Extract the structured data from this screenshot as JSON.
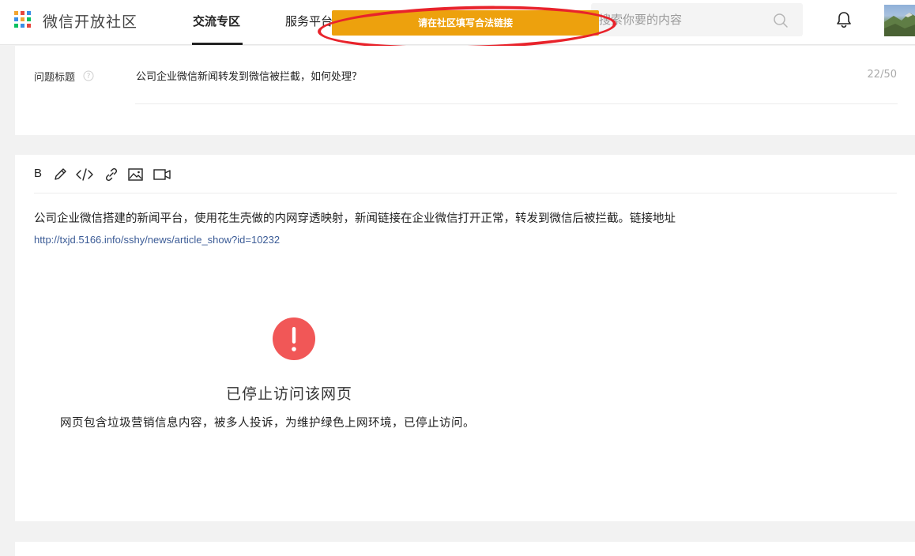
{
  "header": {
    "logo_text": "微信开放社区",
    "nav": [
      {
        "label": "交流专区",
        "active": true
      },
      {
        "label": "服务平台",
        "active": false
      }
    ],
    "search": {
      "placeholder": "搜索你要的内容"
    },
    "toast": "请在社区填写合法链接"
  },
  "question": {
    "label": "问题标题",
    "title_value": "公司企业微信新闻转发到微信被拦截，如何处理？",
    "char_count": "22/50"
  },
  "editor": {
    "toolbar": {
      "bold": "B"
    },
    "body_text": "公司企业微信搭建的新闻平台，使用花生壳做的内网穿透映射，新闻链接在企业微信打开正常，转发到微信后被拦截。链接地址",
    "link": "http://txjd.5166.info/sshy/news/article_show?id=10232",
    "blocked": {
      "icon_mark": "!",
      "title": "已停止访问该网页",
      "description": "网页包含垃圾营销信息内容，被多人投诉，为维护绿色上网环境，已停止访问。"
    }
  },
  "colors": {
    "toast": "#eda10d",
    "annotation": "#e8232b",
    "warning": "#f15757",
    "link": "#3b5b96"
  }
}
